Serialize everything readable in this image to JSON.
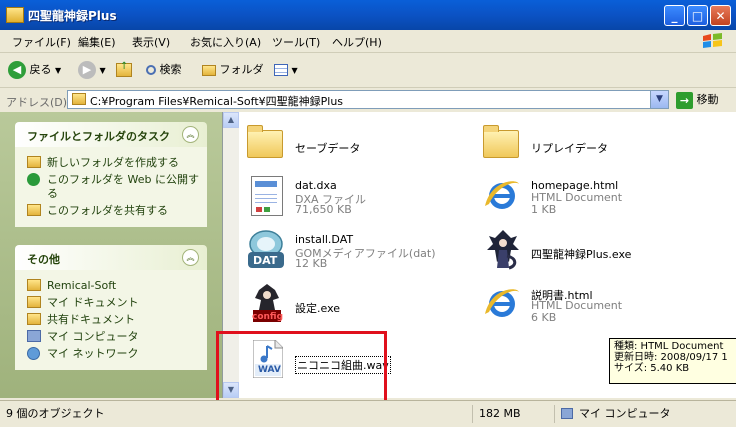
{
  "window": {
    "title": "四聖龍神録Plus",
    "controls": {
      "minimize": "_",
      "maximize": "□",
      "close": "✕"
    }
  },
  "menu": [
    "ファイル(F)",
    "編集(E)",
    "表示(V)",
    "お気に入り(A)",
    "ツール(T)",
    "ヘルプ(H)"
  ],
  "toolbar": {
    "back_label": "戻る",
    "search_label": "検索",
    "folders_label": "フォルダ"
  },
  "address": {
    "label": "アドレス(D)",
    "path": "C:¥Program Files¥Remical-Soft¥四聖龍神録Plus",
    "go_label": "移動"
  },
  "tasks": {
    "title": "ファイルとフォルダのタスク",
    "items": [
      "新しいフォルダを作成する",
      "このフォルダを Web に公開する",
      "このフォルダを共有する"
    ]
  },
  "other": {
    "title": "その他",
    "items": [
      "Remical-Soft",
      "マイ ドキュメント",
      "共有ドキュメント",
      "マイ コンピュータ",
      "マイ ネットワーク"
    ]
  },
  "files": [
    {
      "name": "セーブデータ",
      "type": "",
      "size": ""
    },
    {
      "name": "リプレイデータ",
      "type": "",
      "size": ""
    },
    {
      "name": "dat.dxa",
      "type": "DXA ファイル",
      "size": "71,650 KB"
    },
    {
      "name": "homepage.html",
      "type": "HTML Document",
      "size": "1 KB"
    },
    {
      "name": "install.DAT",
      "type": "GOMメディアファイル(dat)",
      "size": "12 KB"
    },
    {
      "name": "四聖龍神録Plus.exe",
      "type": "",
      "size": ""
    },
    {
      "name": "設定.exe",
      "type": "",
      "size": ""
    },
    {
      "name": "説明書.html",
      "type": "HTML Document",
      "size": "6 KB"
    },
    {
      "name": "ニコニコ組曲.wav",
      "type": "",
      "size": ""
    }
  ],
  "tooltip": {
    "line1": "種類: HTML Document",
    "line2": "更新日時: 2008/09/17 1",
    "line3": "サイズ: 5.40 KB"
  },
  "status": {
    "objects": "9 個のオブジェクト",
    "size": "182 MB",
    "location": "マイ コンピュータ"
  },
  "icon_labels": {
    "dat": "DAT",
    "wav": "WAV",
    "config": "config"
  }
}
